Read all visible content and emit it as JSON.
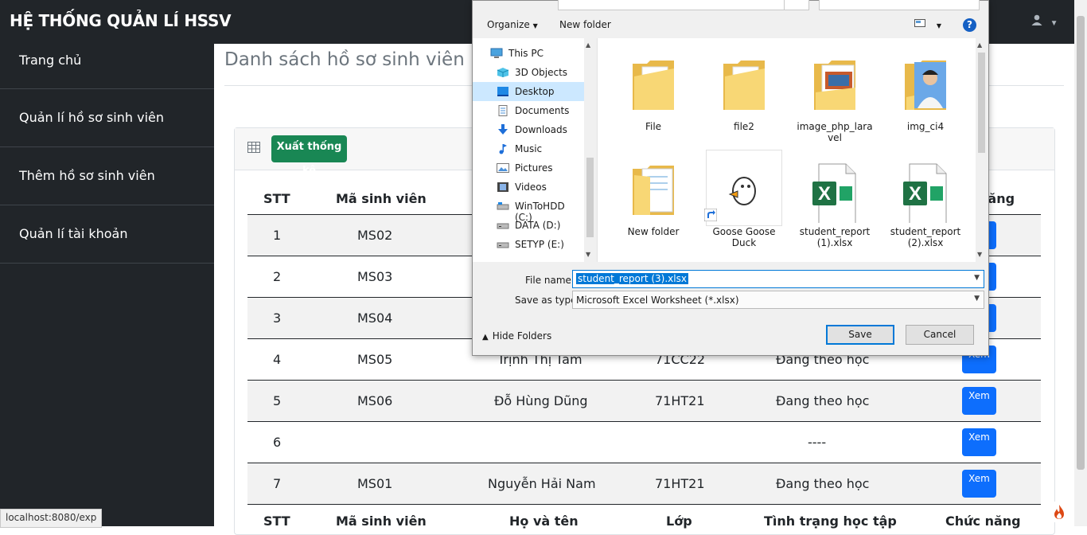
{
  "app": {
    "title": "HỆ THỐNG QUẢN LÍ HSSV"
  },
  "sidebar": {
    "items": [
      {
        "label": "Trang chủ"
      },
      {
        "label": "Quản lí hồ sơ sinh viên"
      },
      {
        "label": "Thêm hồ sơ sinh viên"
      },
      {
        "label": "Quản lí tài khoản"
      }
    ]
  },
  "page": {
    "title": "Danh sách hồ sơ sinh viên",
    "export_label": "Xuất thống kê"
  },
  "table": {
    "headers": [
      "STT",
      "Mã sinh viên",
      "Họ và tên",
      "Lớp",
      "Tình trạng học tập",
      "Chức năng"
    ],
    "header_top_visible": [
      "STT",
      "Mã sinh viên",
      "năng"
    ],
    "action_label": "Xem",
    "rows": [
      {
        "stt": "1",
        "ma": "MS02",
        "ten": "",
        "lop": "",
        "tinh_trang": ""
      },
      {
        "stt": "2",
        "ma": "MS03",
        "ten": "",
        "lop": "",
        "tinh_trang": ""
      },
      {
        "stt": "3",
        "ma": "MS04",
        "ten": "",
        "lop": "",
        "tinh_trang": ""
      },
      {
        "stt": "4",
        "ma": "MS05",
        "ten": "Trịnh Thị Tâm",
        "lop": "71CC22",
        "tinh_trang": "Đang theo học"
      },
      {
        "stt": "5",
        "ma": "MS06",
        "ten": "Đỗ Hùng Dũng",
        "lop": "71HT21",
        "tinh_trang": "Đang theo học"
      },
      {
        "stt": "6",
        "ma": "",
        "ten": "",
        "lop": "",
        "tinh_trang": "----"
      },
      {
        "stt": "7",
        "ma": "MS01",
        "ten": "Nguyễn Hải Nam",
        "lop": "71HT21",
        "tinh_trang": "Đang theo học"
      }
    ]
  },
  "status_bar": {
    "url": "localhost:8080/exp"
  },
  "dialog": {
    "toolbar": {
      "organize": "Organize",
      "new_folder": "New folder",
      "help": "?"
    },
    "nav": [
      {
        "label": "This PC",
        "icon": "pc-icon"
      },
      {
        "label": "3D Objects",
        "icon": "cube-icon"
      },
      {
        "label": "Desktop",
        "icon": "desktop-icon",
        "selected": true
      },
      {
        "label": "Documents",
        "icon": "document-icon"
      },
      {
        "label": "Downloads",
        "icon": "download-icon"
      },
      {
        "label": "Music",
        "icon": "music-icon"
      },
      {
        "label": "Pictures",
        "icon": "pictures-icon"
      },
      {
        "label": "Videos",
        "icon": "videos-icon"
      },
      {
        "label": "WinToHDD (C:)",
        "icon": "drive-icon"
      },
      {
        "label": "DATA (D:)",
        "icon": "drive-icon"
      },
      {
        "label": "SETYP (E:)",
        "icon": "drive-icon"
      }
    ],
    "files": [
      {
        "label": "File",
        "kind": "folder"
      },
      {
        "label": "file2",
        "kind": "folder"
      },
      {
        "label": "image_php_laravel",
        "kind": "folder-image"
      },
      {
        "label": "img_ci4",
        "kind": "folder-photo"
      },
      {
        "label": "New folder",
        "kind": "folder-doc"
      },
      {
        "label": "Goose Goose Duck",
        "kind": "shortcut"
      },
      {
        "label": "student_report (1).xlsx",
        "kind": "excel"
      },
      {
        "label": "student_report (2).xlsx",
        "kind": "excel"
      }
    ],
    "file_name_label": "File name:",
    "file_name_value": "student_report (3).xlsx",
    "save_type_label": "Save as type:",
    "save_type_value": "Microsoft Excel Worksheet (*.xlsx)",
    "hide_folders": "Hide Folders",
    "save": "Save",
    "cancel": "Cancel"
  },
  "colors": {
    "navbar": "#212529",
    "export": "#198754",
    "xem": "#0d6efd",
    "selection": "#0078d7"
  }
}
